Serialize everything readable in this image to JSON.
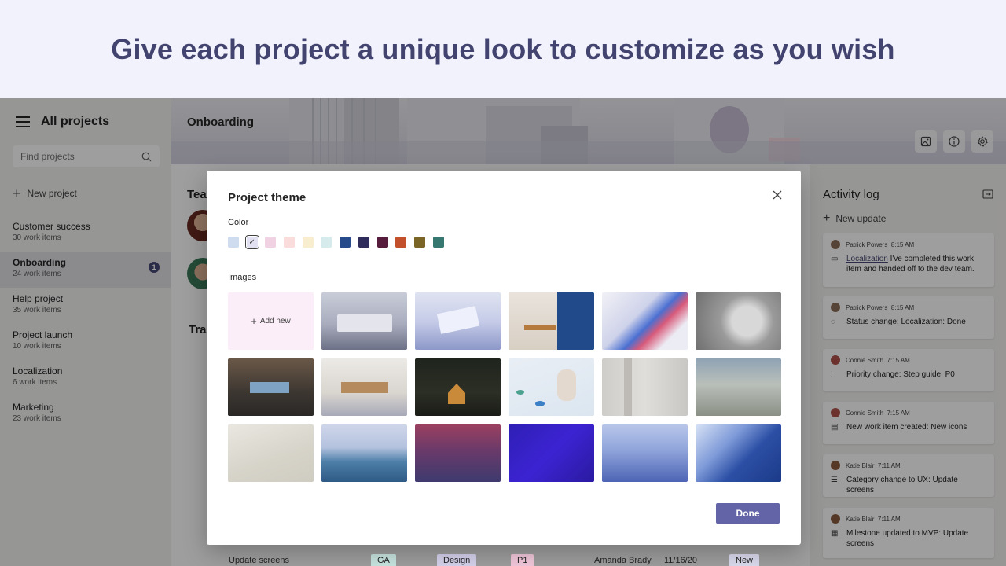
{
  "banner": {
    "headline": "Give each project a unique look to customize as you wish"
  },
  "sidebar": {
    "title": "All projects",
    "search_placeholder": "Find projects",
    "new_project": "New project",
    "projects": [
      {
        "name": "Customer success",
        "count": "30 work items"
      },
      {
        "name": "Onboarding",
        "count": "24 work items",
        "badge": "1"
      },
      {
        "name": "Help project",
        "count": "35 work items"
      },
      {
        "name": "Project launch",
        "count": "10 work items"
      },
      {
        "name": "Localization",
        "count": "6 work items"
      },
      {
        "name": "Marketing",
        "count": "23 work items"
      }
    ]
  },
  "header": {
    "title": "Onboarding"
  },
  "content": {
    "team_label": "Tean",
    "tracking_label": "Trac"
  },
  "activity": {
    "title": "Activity log",
    "new_update": "New update",
    "entries": [
      {
        "who": "Patrick Powers",
        "time": "8:15 AM",
        "link": "Localization",
        "text": " I've completed this work item and handed off to the dev team."
      },
      {
        "who": "Patrick Powers",
        "time": "8:15 AM",
        "link": "",
        "text": "Status change: Localization: Done"
      },
      {
        "who": "Connie Smith",
        "time": "7:15 AM",
        "link": "",
        "text": "Priority change: Step guide: P0"
      },
      {
        "who": "Connie Smith",
        "time": "7:15 AM",
        "link": "",
        "text": "New work item created: New icons"
      },
      {
        "who": "Katie Blair",
        "time": "7:11 AM",
        "link": "",
        "text": "Category change to UX: Update screens"
      },
      {
        "who": "Katie Blair",
        "time": "7:11 AM",
        "link": "",
        "text": "Milestone updated to MVP: Update screens"
      }
    ]
  },
  "modal": {
    "title": "Project theme",
    "color_label": "Color",
    "colors": [
      "#cfdcef",
      "#e1e1f2",
      "#f0d2e3",
      "#fbdcdc",
      "#f8eecf",
      "#d6ecec",
      "#264a8a",
      "#2f2b5b",
      "#571b3b",
      "#c2512b",
      "#7a6526",
      "#36786f"
    ],
    "selected_color": 1,
    "images_label": "Images",
    "add_new": "Add new",
    "done": "Done"
  },
  "bottom_row": {
    "item": "Update screens",
    "tag1": "GA",
    "tag2": "Design",
    "tag3": "P1",
    "person": "Amanda Brady",
    "date": "11/16/20",
    "status": "New"
  }
}
